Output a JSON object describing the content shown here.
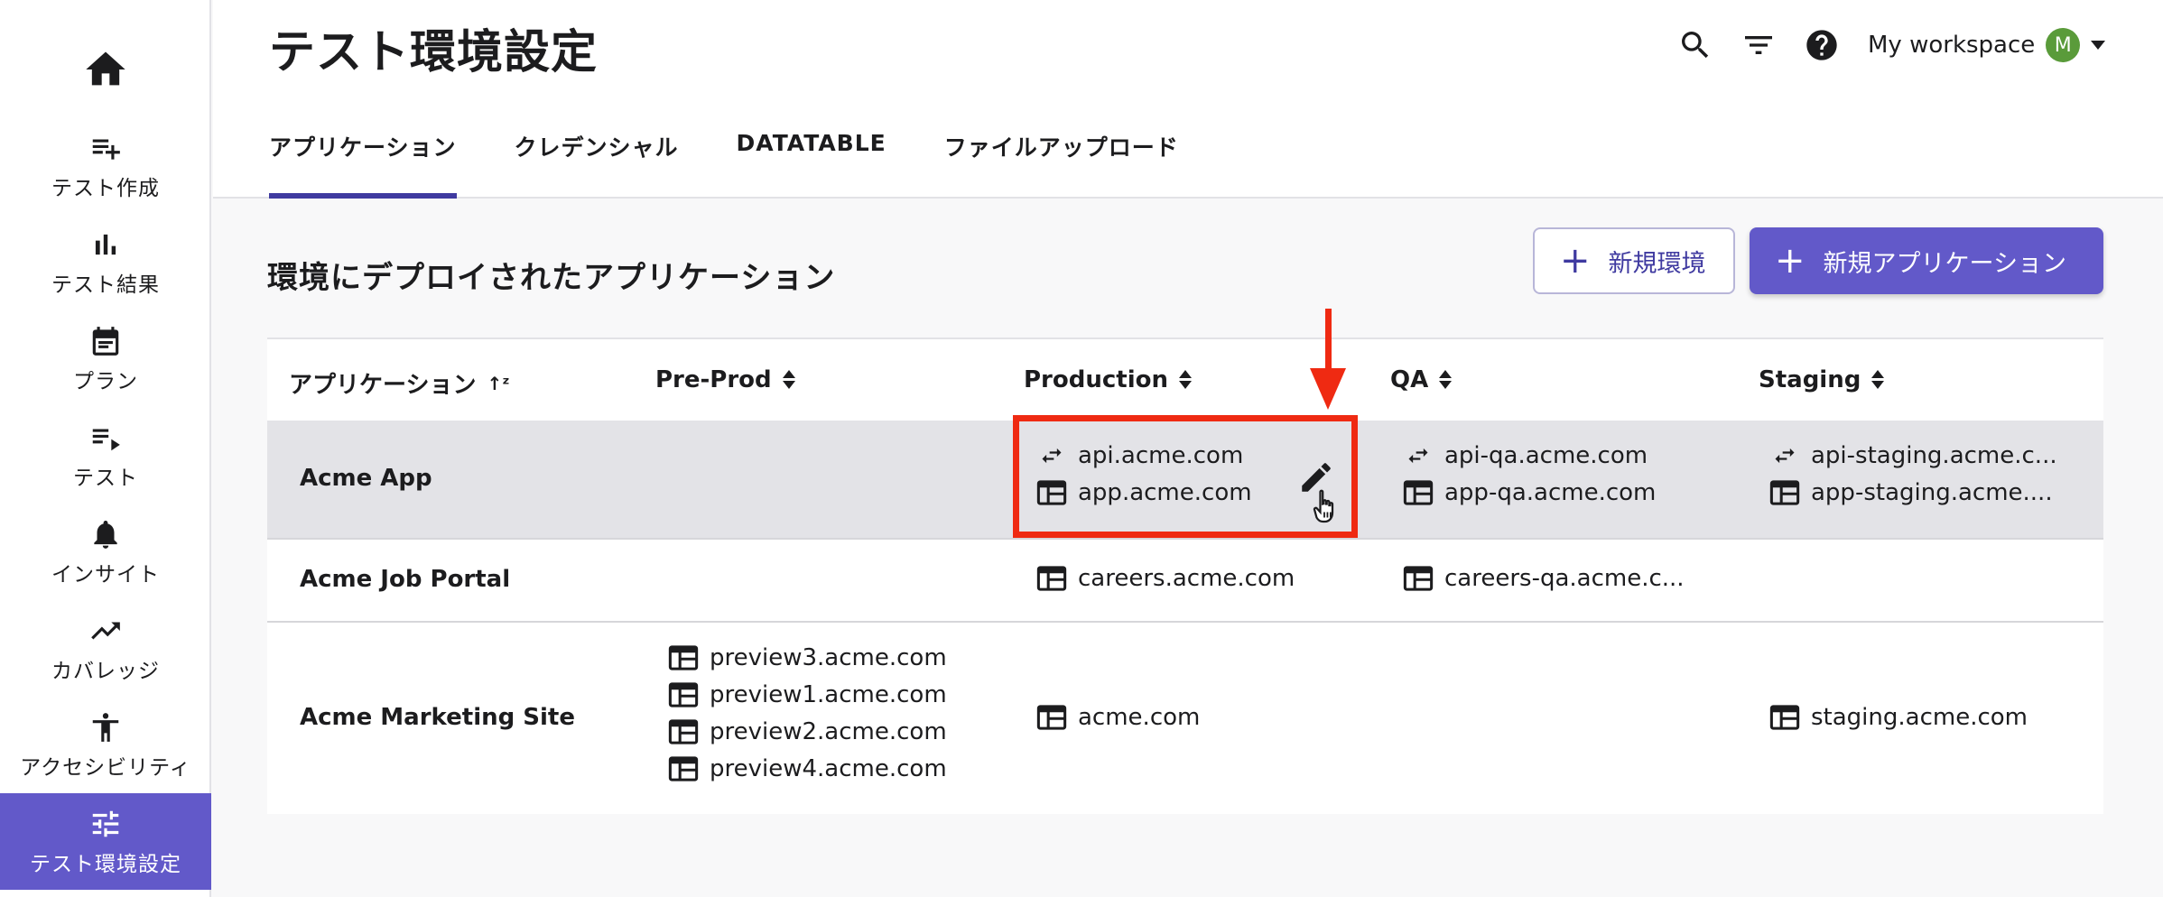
{
  "sidebar": {
    "home_icon": "home-icon",
    "items": [
      {
        "label": "テスト作成",
        "icon": "playlist-add-icon"
      },
      {
        "label": "テスト結果",
        "icon": "bar-chart-icon"
      },
      {
        "label": "プラン",
        "icon": "calendar-icon"
      },
      {
        "label": "テスト",
        "icon": "playlist-play-icon"
      },
      {
        "label": "インサイト",
        "icon": "bell-icon"
      },
      {
        "label": "カバレッジ",
        "icon": "trending-up-icon"
      },
      {
        "label": "アクセシビリティ",
        "icon": "accessibility-icon"
      },
      {
        "label": "テスト環境設定",
        "icon": "tune-icon",
        "active": true
      }
    ]
  },
  "header": {
    "title": "テスト環境設定",
    "workspace_label": "My workspace",
    "avatar_initial": "M",
    "avatar_color": "#5a9b3a"
  },
  "tabs": [
    {
      "label": "アプリケーション",
      "active": true
    },
    {
      "label": "クレデンシャル"
    },
    {
      "label": "DATATABLE"
    },
    {
      "label": "ファイルアップロード"
    }
  ],
  "section": {
    "title": "環境にデプロイされたアプリケーション",
    "new_env_label": "新規環境",
    "new_app_label": "新規アプリケーション"
  },
  "table": {
    "columns": [
      "アプリケーション",
      "Pre-Prod",
      "Production",
      "QA",
      "Staging"
    ],
    "rows": [
      {
        "name": "Acme App",
        "production": [
          "api.acme.com",
          "app.acme.com"
        ],
        "qa": [
          "api-qa.acme.com",
          "app-qa.acme.com"
        ],
        "staging": [
          "api-staging.acme.c...",
          "app-staging.acme...."
        ]
      },
      {
        "name": "Acme Job Portal",
        "production": [
          "careers.acme.com"
        ],
        "qa": [
          "careers-qa.acme.c..."
        ]
      },
      {
        "name": "Acme Marketing Site",
        "preprod": [
          "preview3.acme.com",
          "preview1.acme.com",
          "preview2.acme.com",
          "preview4.acme.com"
        ],
        "production": [
          "acme.com"
        ],
        "staging": [
          "staging.acme.com"
        ]
      }
    ]
  },
  "colors": {
    "accent": "#6259c9",
    "tab_underline": "#3f3aa0",
    "annotation": "#ef2a12",
    "selected_row": "#e3e3e7"
  }
}
